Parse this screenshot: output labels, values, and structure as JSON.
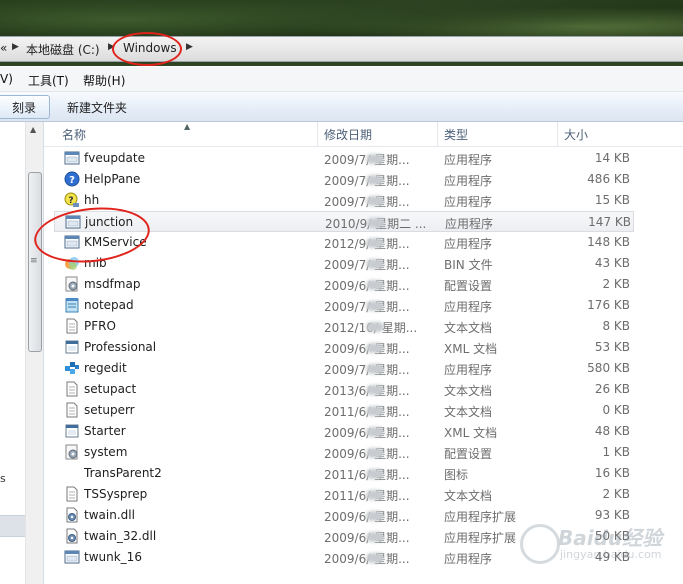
{
  "address_bar": {
    "crumbs": [
      {
        "label": "«"
      },
      {
        "label": "本地磁盘 (C:)"
      },
      {
        "label": "Windows"
      }
    ]
  },
  "menu_bar": {
    "items": [
      {
        "label": "V)"
      },
      {
        "label": "工具(T)"
      },
      {
        "label": "帮助(H)"
      }
    ]
  },
  "toolbar": {
    "burn_label": "刻录",
    "new_folder_label": "新建文件夹"
  },
  "nav_pane": {
    "partial_text": "s"
  },
  "columns": {
    "name": "名称",
    "date": "修改日期",
    "type": "类型",
    "size": "大小"
  },
  "files": [
    {
      "name": "fveupdate",
      "date": "2009/7/    星期...",
      "type": "应用程序",
      "size": "14 KB",
      "icon": "app-window-icon"
    },
    {
      "name": "HelpPane",
      "date": "2009/7/    星期...",
      "type": "应用程序",
      "size": "486 KB",
      "icon": "help-icon"
    },
    {
      "name": "hh",
      "date": "2009/7/    星期...",
      "type": "应用程序",
      "size": "15 KB",
      "icon": "help-bulb-icon"
    },
    {
      "name": "junction",
      "date": "2010/9/    星期二 ...",
      "type": "应用程序",
      "size": "147 KB",
      "icon": "app-window-icon"
    },
    {
      "name": "KMService",
      "date": "2012/9/    星期...",
      "type": "应用程序",
      "size": "148 KB",
      "icon": "app-window-icon"
    },
    {
      "name": "mib",
      "date": "2009/7/    星期...",
      "type": "BIN 文件",
      "size": "43 KB",
      "icon": "colorful-file-icon"
    },
    {
      "name": "msdfmap",
      "date": "2009/6/    星期...",
      "type": "配置设置",
      "size": "2 KB",
      "icon": "config-gear-icon"
    },
    {
      "name": "notepad",
      "date": "2009/7/    星期...",
      "type": "应用程序",
      "size": "176 KB",
      "icon": "notepad-icon"
    },
    {
      "name": "PFRO",
      "date": "2012/10/    星期...",
      "type": "文本文档",
      "size": "8 KB",
      "icon": "text-document-icon"
    },
    {
      "name": "Professional",
      "date": "2009/6/    星期...",
      "type": "XML 文档",
      "size": "53 KB",
      "icon": "xml-document-icon"
    },
    {
      "name": "regedit",
      "date": "2009/7/    星期...",
      "type": "应用程序",
      "size": "580 KB",
      "icon": "registry-icon"
    },
    {
      "name": "setupact",
      "date": "2013/6/    星期...",
      "type": "文本文档",
      "size": "26 KB",
      "icon": "text-document-icon"
    },
    {
      "name": "setuperr",
      "date": "2011/6/    星期...",
      "type": "文本文档",
      "size": "0 KB",
      "icon": "text-document-icon"
    },
    {
      "name": "Starter",
      "date": "2009/6/    星期...",
      "type": "XML 文档",
      "size": "48 KB",
      "icon": "xml-document-icon"
    },
    {
      "name": "system",
      "date": "2009/6/    星期...",
      "type": "配置设置",
      "size": "1 KB",
      "icon": "config-gear-icon"
    },
    {
      "name": "TransParent2",
      "date": "2011/6/    星期...",
      "type": "图标",
      "size": "16 KB",
      "icon": "blank-icon"
    },
    {
      "name": "TSSysprep",
      "date": "2011/6/    星期...",
      "type": "文本文档",
      "size": "2 KB",
      "icon": "text-document-icon"
    },
    {
      "name": "twain.dll",
      "date": "2009/6/    星期...",
      "type": "应用程序扩展",
      "size": "93 KB",
      "icon": "dll-gear-icon"
    },
    {
      "name": "twain_32.dll",
      "date": "2009/6/    星期...",
      "type": "应用程序扩展",
      "size": "50 KB",
      "icon": "dll-gear-icon"
    },
    {
      "name": "twunk_16",
      "date": "2009/6/    星期...",
      "type": "应用程序",
      "size": "49 KB",
      "icon": "app-window-icon"
    }
  ],
  "watermark": {
    "title": "Baidu经验",
    "sub": "jingyan.baidu.com"
  },
  "colors": {
    "annotation_red": "#e0231c",
    "header_text": "#4c607a",
    "toolbar_bg": "#e6eef7"
  }
}
